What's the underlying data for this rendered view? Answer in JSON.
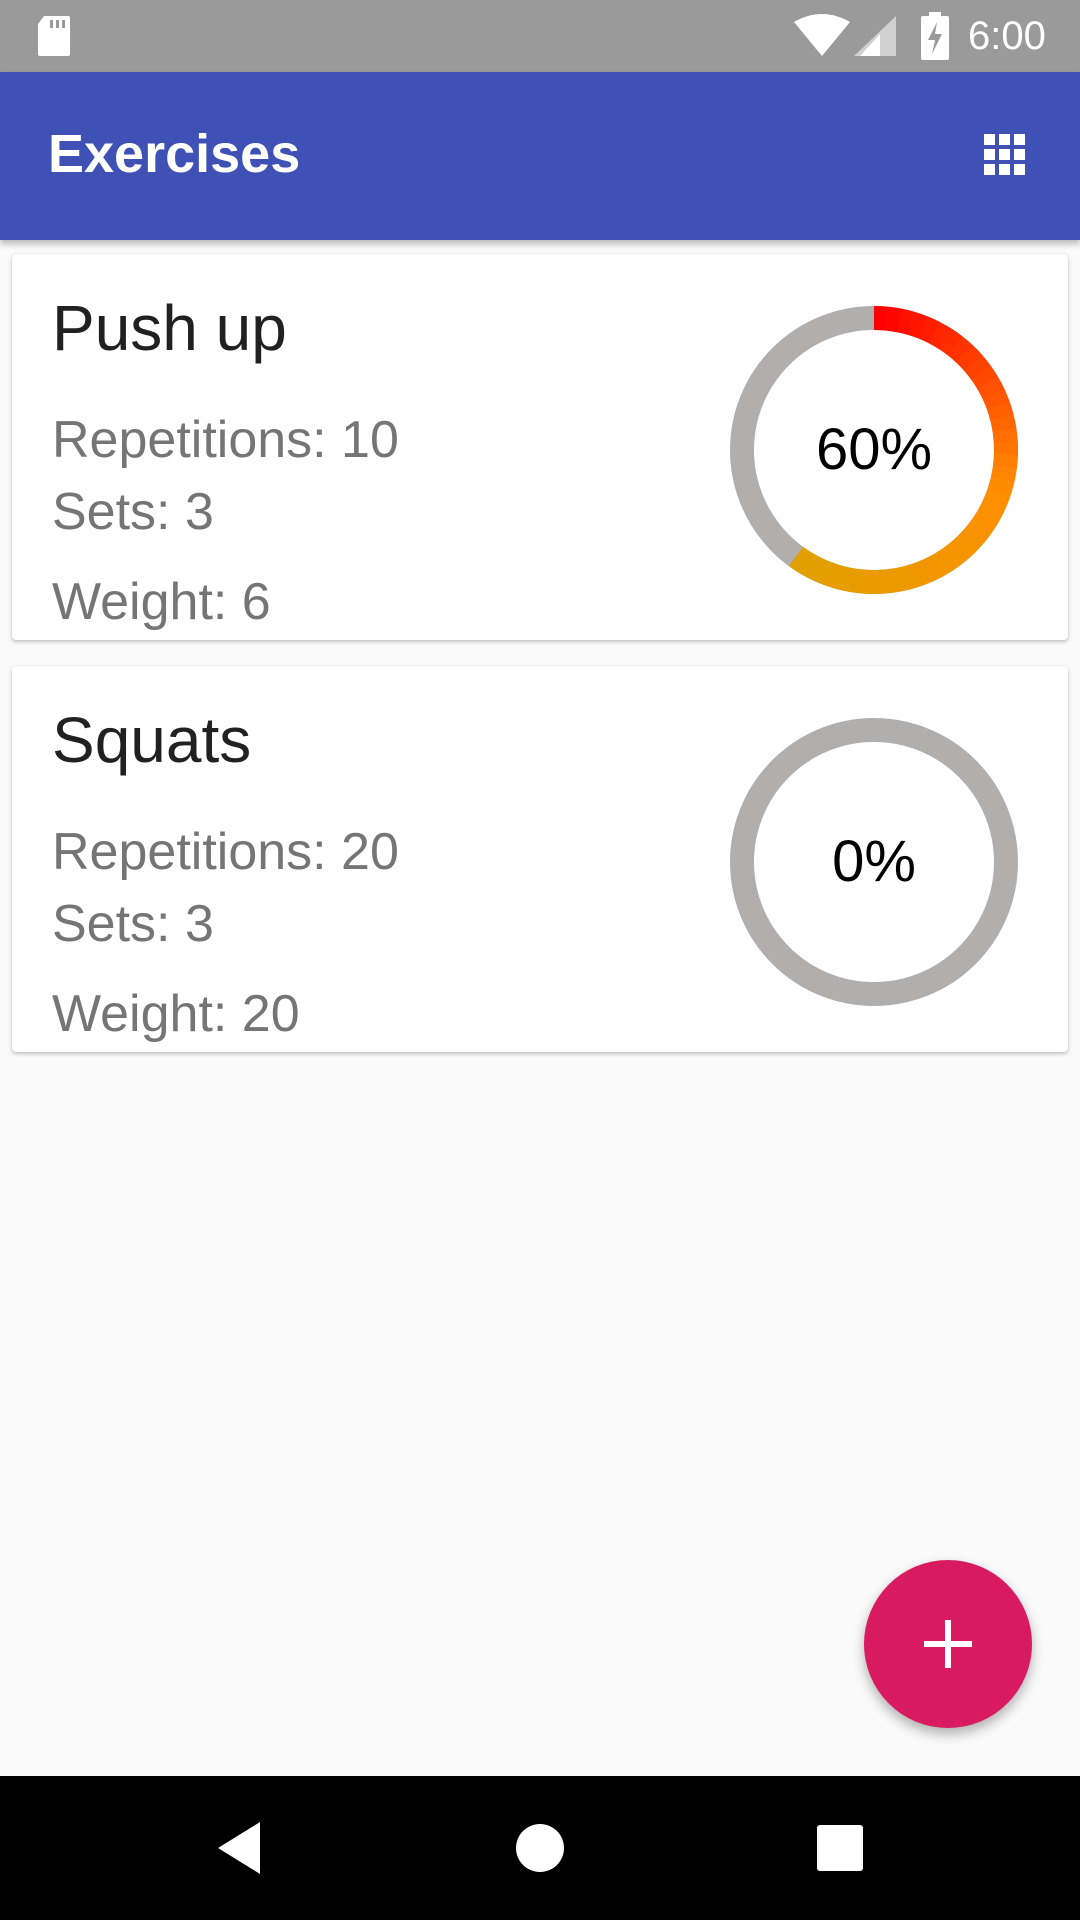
{
  "status_bar": {
    "time": "6:00",
    "icons": [
      "sd-card-icon",
      "wifi-icon",
      "cell-signal-icon",
      "battery-charging-icon"
    ]
  },
  "app_bar": {
    "title": "Exercises",
    "action_icon": "grid-icon"
  },
  "exercises": [
    {
      "name": "Push up",
      "repetitions": "Repetitions: 10",
      "sets": "Sets: 3",
      "weight": "Weight: 6",
      "progress_label": "60%",
      "progress": 0.6
    },
    {
      "name": "Squats",
      "repetitions": "Repetitions: 20",
      "sets": "Sets: 3",
      "weight": "Weight: 20",
      "progress_label": "0%",
      "progress": 0
    }
  ],
  "fab": {
    "icon": "plus-icon"
  },
  "nav_bar": {
    "buttons": [
      "back-icon",
      "home-icon",
      "recents-icon"
    ]
  },
  "colors": {
    "status_bar": "#9a9a9a",
    "app_bar": "#3f51b5",
    "background": "#fafafa",
    "fab": "#d81b60",
    "ring_track": "#b1aeae",
    "ring_start": "#ff0000",
    "ring_mid": "#ff8f00",
    "ring_end": "#e0a000"
  }
}
